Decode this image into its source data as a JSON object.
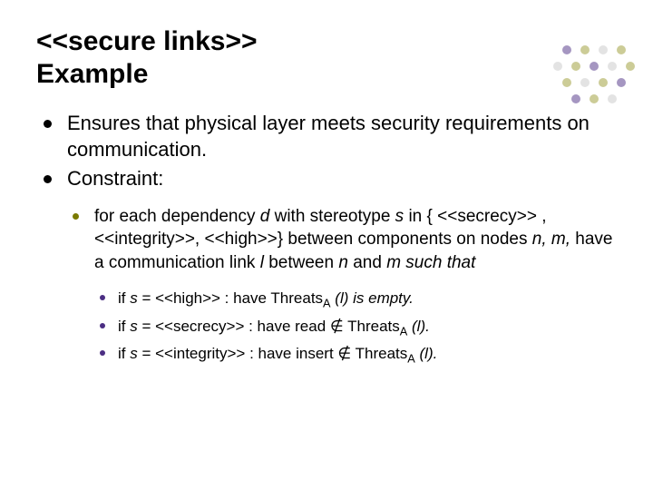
{
  "title_line1": "<<secure links>>",
  "title_line2": " Example",
  "bullets_l1": {
    "b1": "Ensures that physical layer meets security requirements on communication.",
    "b2": "Constraint:"
  },
  "bullets_l2": {
    "b1_pre": "for each dependency ",
    "b1_d": "d",
    "b1_mid1": " with stereotype ",
    "b1_s": "s",
    "b1_mid2": " in { <<secrecy>> , <<integrity>>, <<high>>} between components on nodes ",
    "b1_nm": "n, m,",
    "b1_mid3": " have a communication link ",
    "b1_l": "l",
    "b1_mid4": " between ",
    "b1_n": "n",
    "b1_and": " and ",
    "b1_m": "m",
    "b1_such": " such that"
  },
  "bullets_l3": {
    "b1_pre": "if ",
    "b1_s": "s",
    "b1_eq": " = <<high>> : have Threats",
    "b1_sub": "A",
    "b1_arg": " (l)",
    "b1_post": " is empty.",
    "b2_pre": "if ",
    "b2_s": "s",
    "b2_eq": " = <<secrecy>> : have read ∉ Threats",
    "b2_sub": "A",
    "b2_arg": " (l).",
    "b3_pre": "if ",
    "b3_s": "s",
    "b3_eq": " = <<integrity>> : have insert ∉ Threats",
    "b3_sub": "A",
    "b3_arg": " (l)."
  },
  "decor_colors": {
    "purple": "#4b2e83",
    "olive": "#9a9a2f",
    "gray": "#b8b8b8"
  }
}
